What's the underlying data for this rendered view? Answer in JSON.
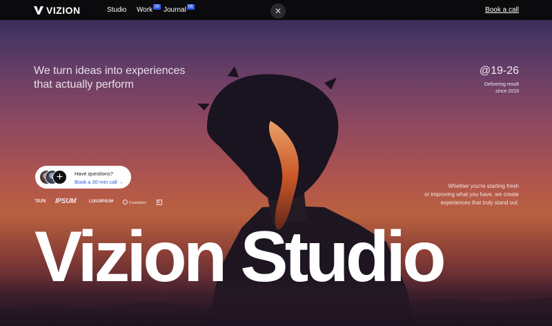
{
  "nav": {
    "brand": "VIZION",
    "links": [
      {
        "label": "Studio",
        "badge": ""
      },
      {
        "label": "Work",
        "badge": "05"
      },
      {
        "label": "Journal",
        "badge": "06"
      }
    ],
    "close_symbol": "✕",
    "cta": "Book a call"
  },
  "hero": {
    "tagline": "We turn ideas into experiences that actually perform",
    "years": "@19-26",
    "years_sub_line1": "Delivering result",
    "years_sub_line2": "since 2019",
    "description_line1": "Whether you're starting fresh",
    "description_line2": "or improving what you have, we create",
    "description_line3": "experiences that truly stand out.",
    "title": "Vizion Studio"
  },
  "questions": {
    "title": "Have questions?",
    "link": "Book a 30-min call →",
    "plus_symbol": "+"
  },
  "clients": [
    "'SUN",
    "IPSUM",
    "LOGOIPSUM",
    "Foundation",
    "L"
  ],
  "colors": {
    "accent": "#2f5bea",
    "nav_bg": "#0b0b0d"
  }
}
